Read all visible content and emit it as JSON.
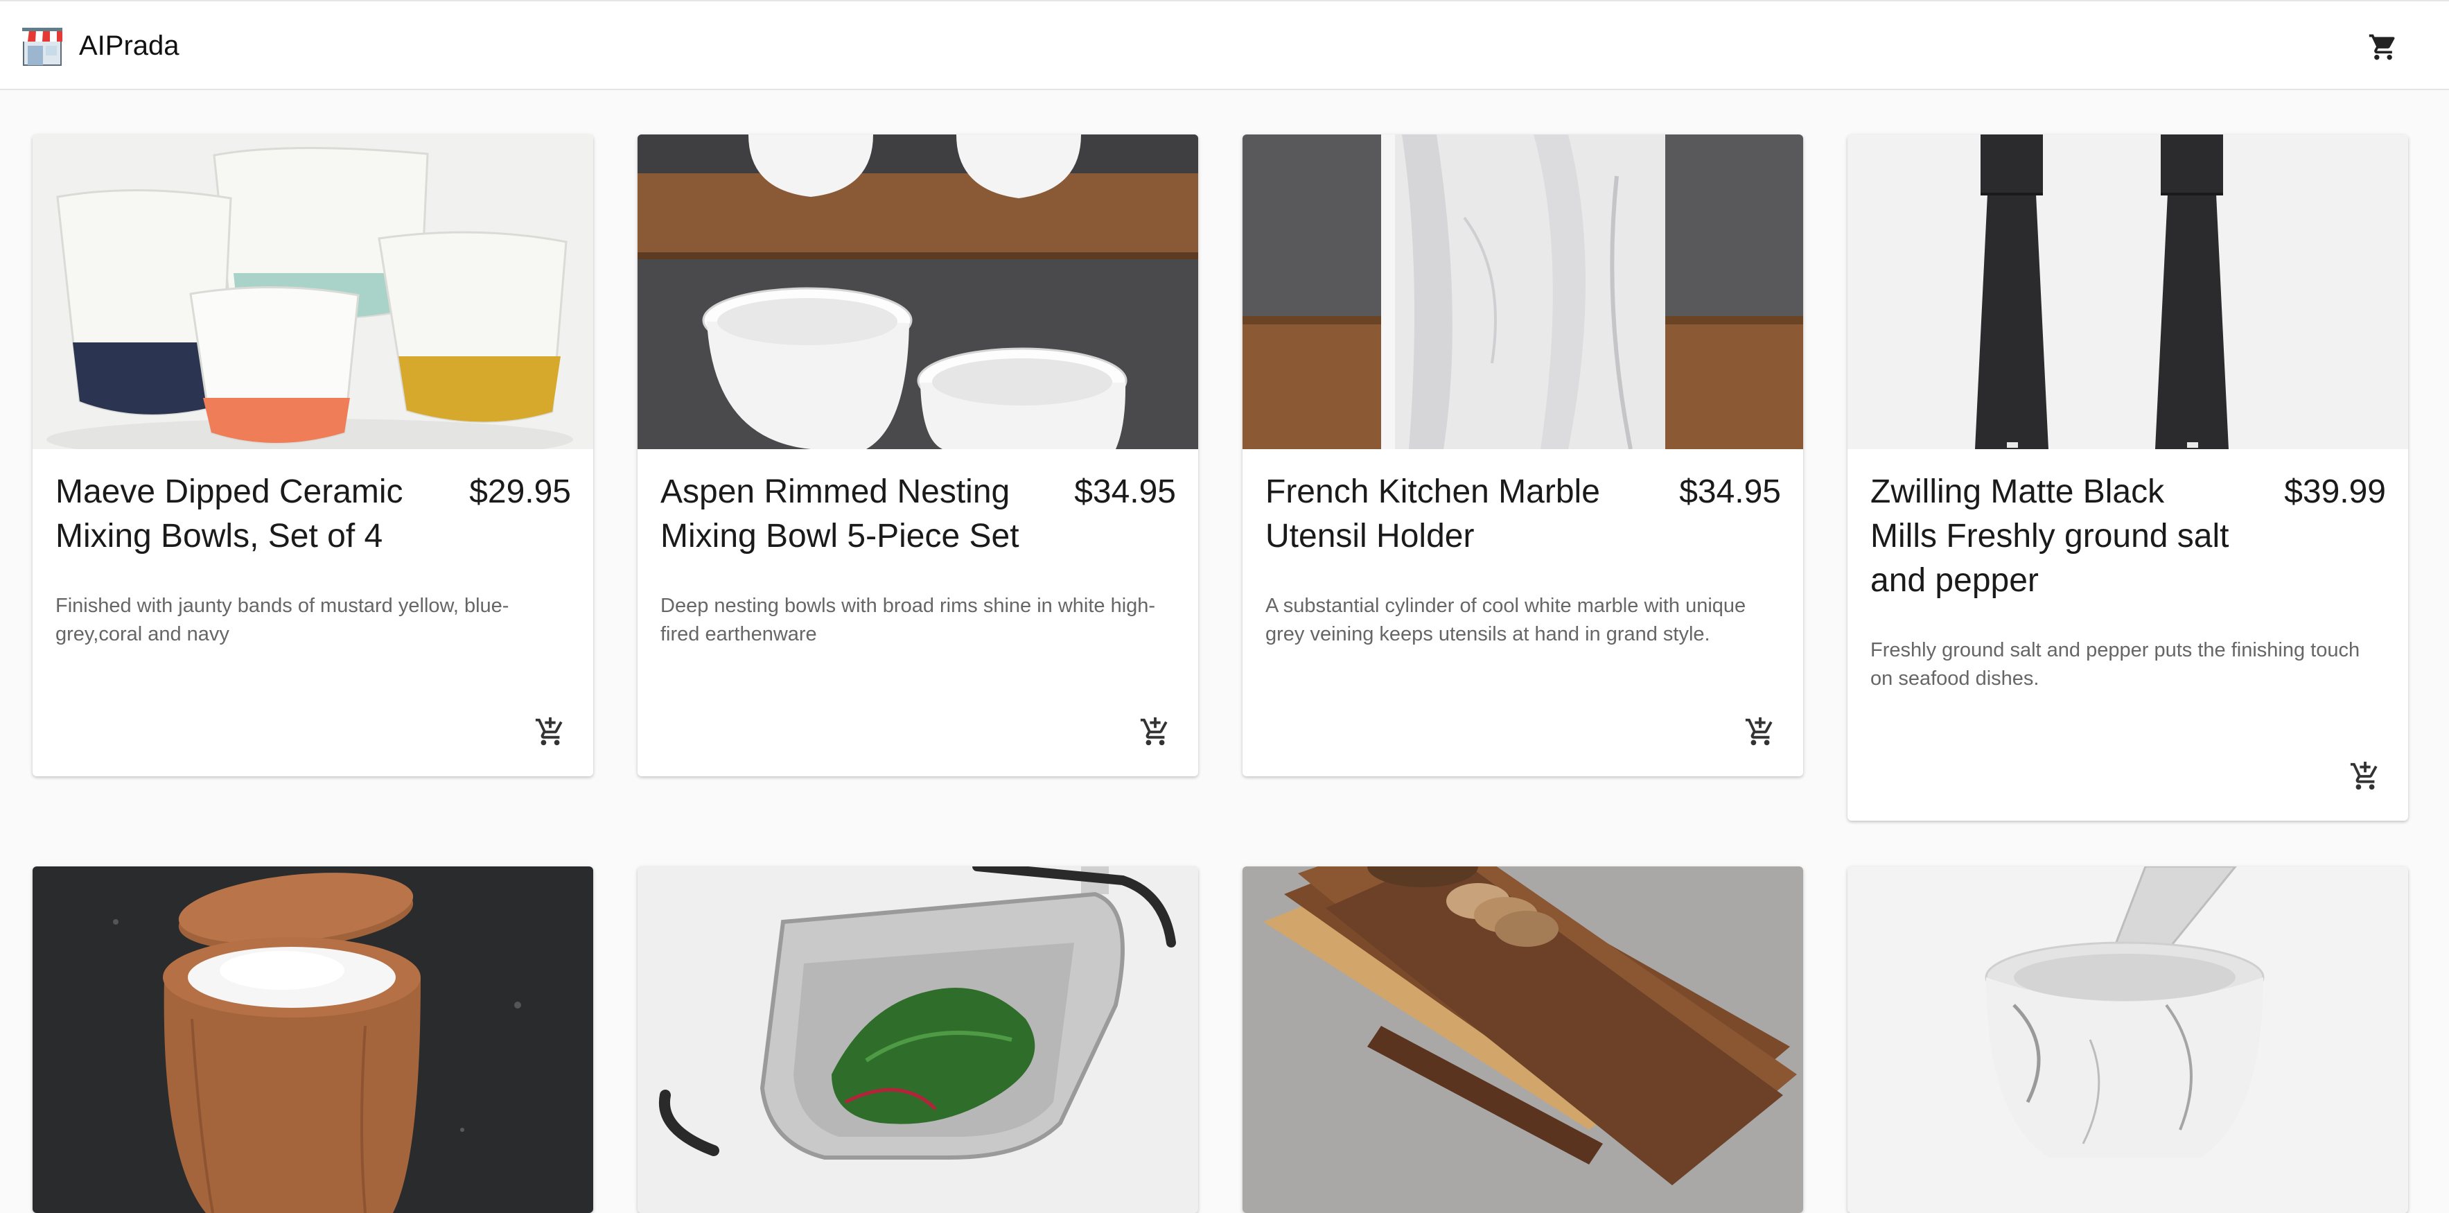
{
  "app": {
    "brand_name": "AIPrada",
    "logo_icon": "storefront-icon",
    "cart_icon": "shopping-cart-icon"
  },
  "products": [
    {
      "title": "Maeve Dipped Ceramic Mixing Bowls, Set of 4",
      "price": "$29.95",
      "description": "Finished with jaunty bands of mustard yellow, blue-grey,coral and navy",
      "image": "mixing-bowls-image",
      "add_icon": "add-to-cart-icon"
    },
    {
      "title": "Aspen Rimmed Nesting Mixing Bowl 5-Piece Set",
      "price": "$34.95",
      "description": "Deep nesting bowls with broad rims shine in white high-fired earthenware",
      "image": "nesting-bowls-image",
      "add_icon": "add-to-cart-icon"
    },
    {
      "title": "French Kitchen Marble Utensil Holder",
      "price": "$34.95",
      "description": "A substantial cylinder of cool white marble with unique grey veining keeps utensils at hand in grand style.",
      "image": "marble-holder-image",
      "add_icon": "add-to-cart-icon"
    },
    {
      "title": "Zwilling Matte Black Mills Freshly ground salt and pepper",
      "price": "$39.99",
      "description": "Freshly ground salt and pepper puts the finishing touch on seafood dishes.",
      "image": "pepper-mills-image",
      "add_icon": "add-to-cart-icon"
    },
    {
      "image": "salt-cellar-image"
    },
    {
      "image": "colander-image"
    },
    {
      "image": "cutting-boards-image"
    },
    {
      "image": "mortar-pestle-image"
    }
  ],
  "colors": {
    "page_background": "#fafafa",
    "card_background": "#ffffff",
    "text_primary": "#1a1a1a",
    "text_secondary": "#666666",
    "icon": "#222222"
  }
}
